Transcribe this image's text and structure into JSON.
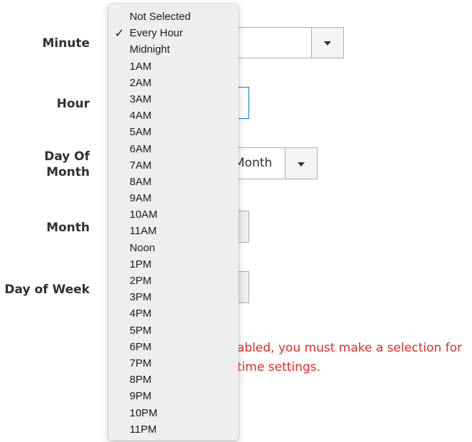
{
  "form": {
    "labels": {
      "minute": "Minute",
      "hour": "Hour",
      "day_of_month_line1": "Day Of",
      "day_of_month_line2": "Month",
      "month": "Month",
      "day_of_week": "Day of Week"
    },
    "day_of_month_value": "Month",
    "note_line1": "abled, you must make a selection for",
    "note_line2": "time settings."
  },
  "dropdown": {
    "selected": "Every Hour",
    "check_glyph": "✓",
    "options": [
      "Not Selected",
      "Every Hour",
      "Midnight",
      "1AM",
      "2AM",
      "3AM",
      "4AM",
      "5AM",
      "6AM",
      "7AM",
      "8AM",
      "9AM",
      "10AM",
      "11AM",
      "Noon",
      "1PM",
      "2PM",
      "3PM",
      "4PM",
      "5PM",
      "6PM",
      "7PM",
      "8PM",
      "9PM",
      "10PM",
      "11PM"
    ]
  },
  "colors": {
    "error_text": "#e02b27",
    "focus_border": "#007bdb",
    "menu_background": "#eeeeee"
  }
}
